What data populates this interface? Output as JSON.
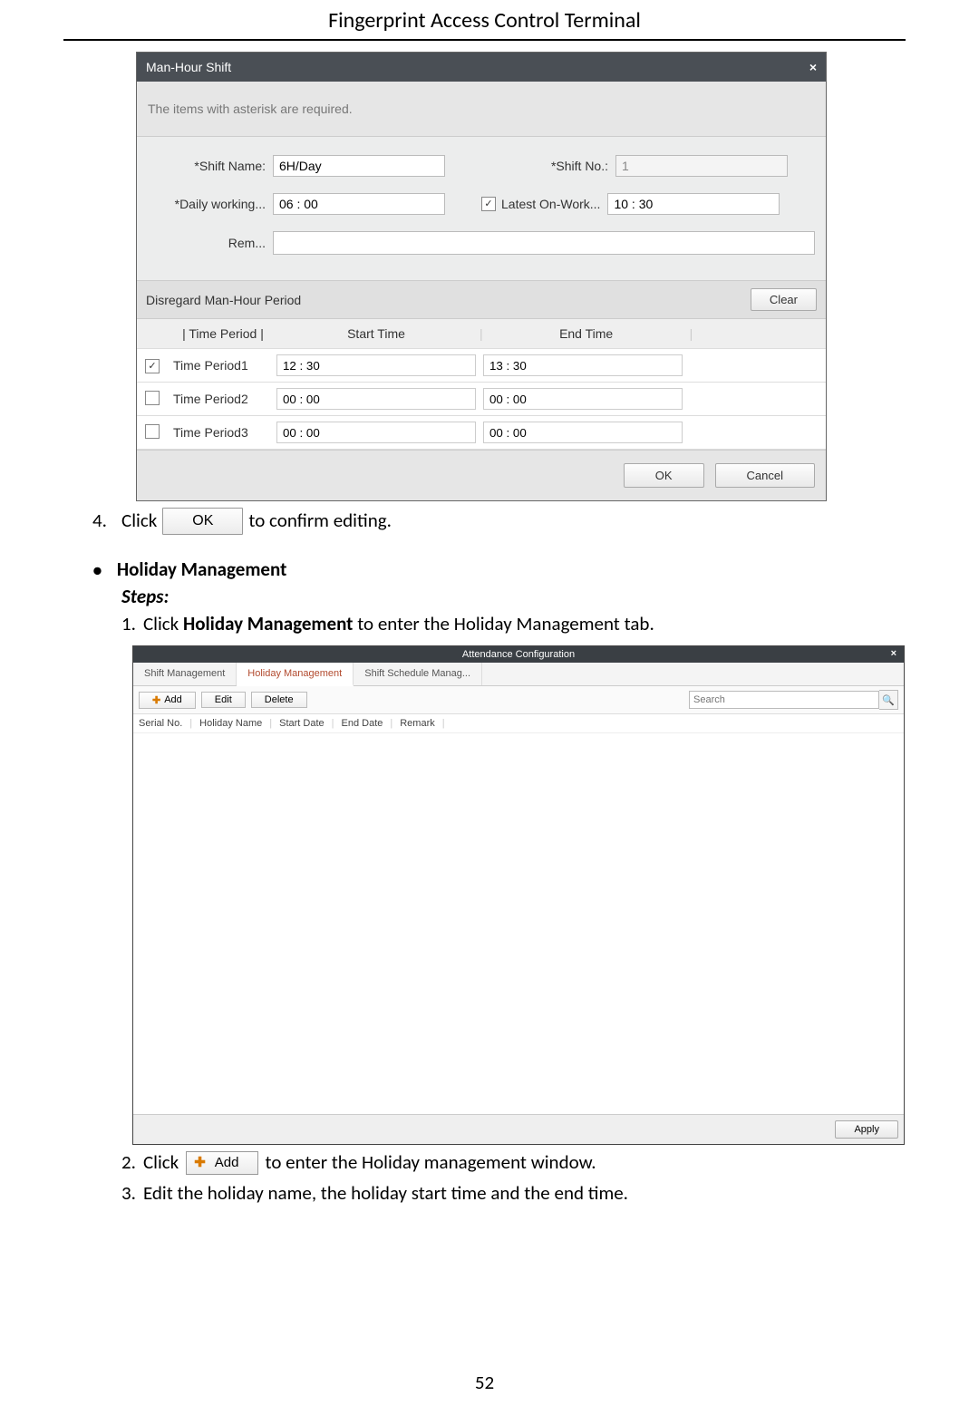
{
  "doc": {
    "header": "Fingerprint Access Control Terminal",
    "page_number": "52"
  },
  "dialog1": {
    "title": "Man-Hour Shift",
    "close": "×",
    "hint": "The items with asterisk are required.",
    "labels": {
      "shift_name": "*Shift Name:",
      "shift_no": "*Shift No.:",
      "daily_working": "*Daily working...",
      "latest_on_work": "Latest On-Work...",
      "rem": "Rem..."
    },
    "values": {
      "shift_name": "6H/Day",
      "shift_no": "1",
      "daily_working": "06 : 00",
      "latest_on_work": "10 : 30"
    },
    "section": {
      "title": "Disregard Man-Hour Period",
      "clear": "Clear",
      "columns": {
        "period": "Time Period",
        "start": "Start Time",
        "end": "End Time"
      },
      "rows": [
        {
          "checked": true,
          "name": "Time Period1",
          "start": "12 : 30",
          "end": "13 : 30"
        },
        {
          "checked": false,
          "name": "Time Period2",
          "start": "00 : 00",
          "end": "00 : 00"
        },
        {
          "checked": false,
          "name": "Time Period3",
          "start": "00 : 00",
          "end": "00 : 00"
        }
      ]
    },
    "buttons": {
      "ok": "OK",
      "cancel": "Cancel"
    }
  },
  "step4": {
    "num": "4.",
    "pre": "Click",
    "btn": "OK",
    "post": "to confirm editing."
  },
  "holiday": {
    "bullet_title": "Holiday Management",
    "steps_label": "Steps:",
    "step1": {
      "num": "1.",
      "pre": "Click ",
      "bold": "Holiday Management",
      "post": " to enter the Holiday Management tab."
    }
  },
  "dialog2": {
    "title": "Attendance Configuration",
    "close": "×",
    "tabs": {
      "t1": "Shift Management",
      "t2": "Holiday Management",
      "t3": "Shift Schedule Manag..."
    },
    "toolbar": {
      "add": "Add",
      "edit": "Edit",
      "delete": "Delete",
      "search_ph": "Search"
    },
    "columns": {
      "serial": "Serial No.",
      "name": "Holiday Name",
      "start": "Start Date",
      "end": "End Date",
      "remark": "Remark"
    },
    "apply": "Apply"
  },
  "post_steps": {
    "s2": {
      "num": "2.",
      "pre": "Click",
      "btn": "Add",
      "post": "to enter the Holiday management window."
    },
    "s3": {
      "num": "3.",
      "text": "Edit the holiday name, the holiday start time and the end time."
    }
  }
}
